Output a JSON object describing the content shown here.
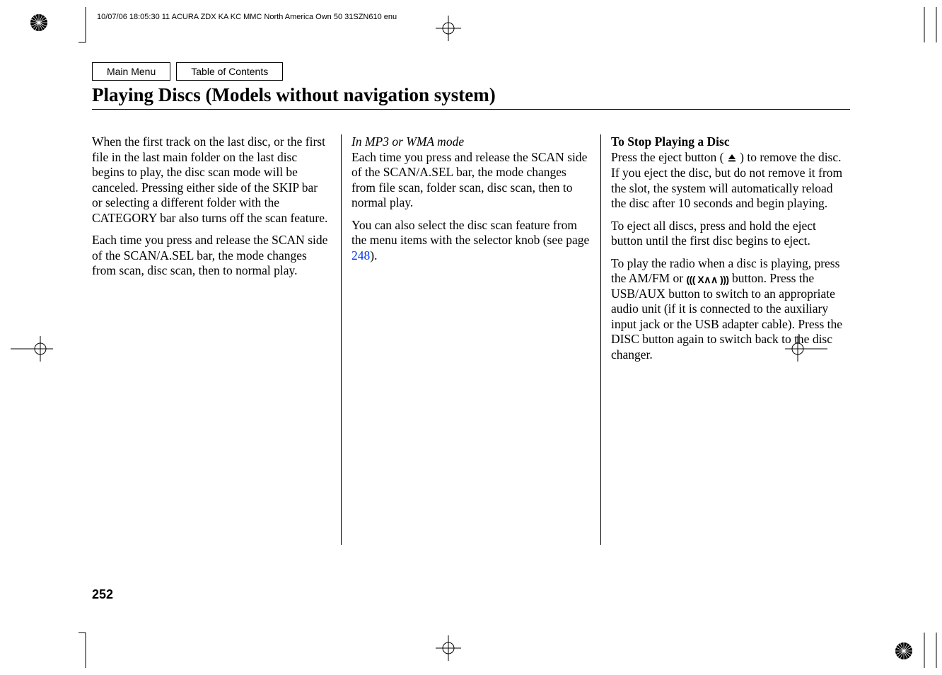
{
  "header_text": "10/07/06 18:05:30   11 ACURA ZDX KA KC MMC North America Own 50 31SZN610 enu",
  "nav": {
    "main_menu": "Main Menu",
    "toc": "Table of Contents"
  },
  "title": "Playing Discs (Models without navigation system)",
  "col1": {
    "p1": "When the first track on the last disc, or the first file in the last main folder on the last disc begins to play, the disc scan mode will be canceled. Pressing either side of the SKIP bar or selecting a different folder with the CATEGORY bar also turns off the scan feature.",
    "p2": "Each time you press and release the SCAN side of the SCAN/A.SEL bar, the mode changes from scan, disc scan, then to normal play."
  },
  "col2": {
    "mode_label": "In MP3 or WMA mode",
    "p1": "Each time you press and release the SCAN side of the SCAN/A.SEL bar, the mode changes from file scan, folder scan, disc scan, then to normal play.",
    "p2a": "You can also select the disc scan feature from the menu items with the selector knob (see page ",
    "p2_link": "248",
    "p2b": ")."
  },
  "col3": {
    "heading": "To Stop Playing a Disc",
    "p1a": "Press the eject button ( ",
    "p1b": " ) to remove the disc. If you eject the disc, but do not remove it from the slot, the system will automatically reload the disc after 10 seconds and begin playing.",
    "p2": "To eject all discs, press and hold the eject button until the first disc begins to eject.",
    "p3a": "To play the radio when a disc is playing, press the AM/FM or ",
    "p3b": " button. Press the USB/AUX button to switch to an appropriate audio unit (if it is connected to the auxiliary input jack or the USB adapter cable). Press the DISC button again to switch back to the disc changer."
  },
  "page_number": "252",
  "icons": {
    "eject": "eject-icon",
    "xm": "xm-icon"
  }
}
